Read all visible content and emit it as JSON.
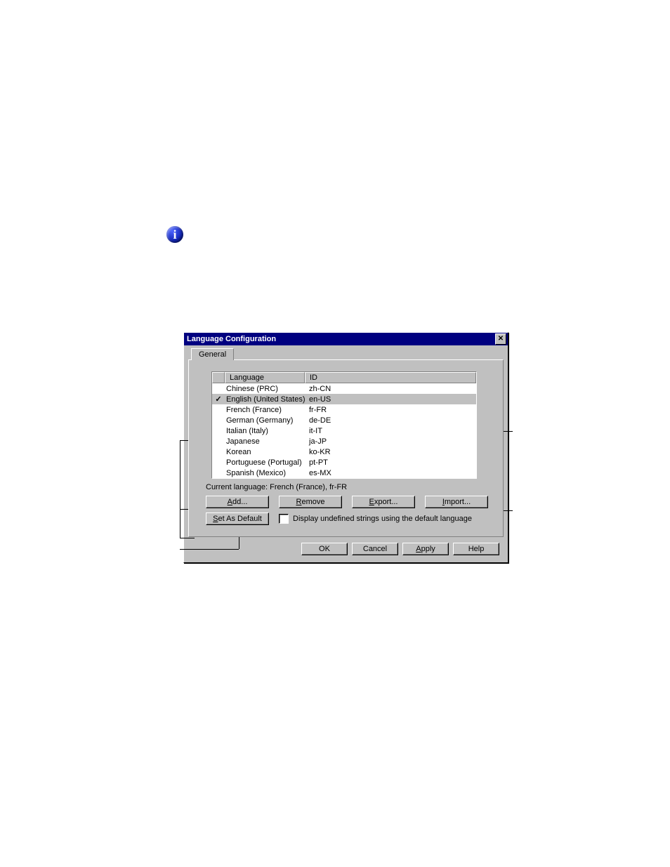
{
  "info_glyph": "i",
  "dialog": {
    "title": "Language Configuration",
    "tab_general": "General",
    "columns": {
      "language": "Language",
      "id": "ID"
    },
    "rows": [
      {
        "check": "",
        "lang": "Chinese (PRC)",
        "id": "zh-CN",
        "selected": false
      },
      {
        "check": "✓",
        "lang": "English (United States)",
        "id": "en-US",
        "selected": true
      },
      {
        "check": "",
        "lang": "French (France)",
        "id": "fr-FR",
        "selected": false
      },
      {
        "check": "",
        "lang": "German (Germany)",
        "id": "de-DE",
        "selected": false
      },
      {
        "check": "",
        "lang": "Italian (Italy)",
        "id": "it-IT",
        "selected": false
      },
      {
        "check": "",
        "lang": "Japanese",
        "id": "ja-JP",
        "selected": false
      },
      {
        "check": "",
        "lang": "Korean",
        "id": "ko-KR",
        "selected": false
      },
      {
        "check": "",
        "lang": "Portuguese (Portugal)",
        "id": "pt-PT",
        "selected": false
      },
      {
        "check": "",
        "lang": "Spanish (Mexico)",
        "id": "es-MX",
        "selected": false
      }
    ],
    "current_language": "Current language: French (France), fr-FR",
    "buttons": {
      "add": {
        "u": "A",
        "rest": "dd..."
      },
      "remove": {
        "u": "R",
        "rest": "emove"
      },
      "export": {
        "u": "E",
        "rest": "xport..."
      },
      "import": {
        "u": "I",
        "rest": "mport..."
      },
      "set_default_pre": "",
      "set_default_u": "S",
      "set_default_rest": "et As Default",
      "ok": "OK",
      "cancel": "Cancel",
      "apply_u": "A",
      "apply_rest": "pply",
      "help": "Help"
    },
    "checkbox_label_u": "D",
    "checkbox_label_rest": "isplay undefined strings using the default language"
  }
}
